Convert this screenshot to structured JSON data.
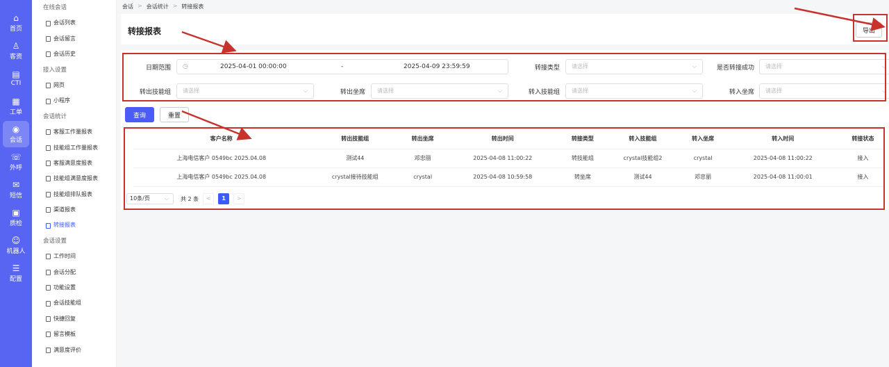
{
  "rail": [
    {
      "icon": "⌂",
      "label": "首页",
      "name": "home"
    },
    {
      "icon": "♙",
      "label": "客资",
      "name": "leads"
    },
    {
      "icon": "▤",
      "label": "CTI",
      "name": "cti"
    },
    {
      "icon": "▦",
      "label": "工单",
      "name": "ticket"
    },
    {
      "icon": "◉",
      "label": "会话",
      "name": "chat",
      "active": true
    },
    {
      "icon": "☏",
      "label": "外呼",
      "name": "outbound"
    },
    {
      "icon": "✉",
      "label": "短信",
      "name": "sms"
    },
    {
      "icon": "▣",
      "label": "质检",
      "name": "qa"
    },
    {
      "icon": "☺",
      "label": "机器人",
      "name": "robot"
    },
    {
      "icon": "☰",
      "label": "配置",
      "name": "config"
    }
  ],
  "menu": [
    {
      "type": "group",
      "label": "在线会话"
    },
    {
      "type": "item",
      "label": "会话列表"
    },
    {
      "type": "item",
      "label": "会话留言"
    },
    {
      "type": "item",
      "label": "会话历史"
    },
    {
      "type": "group",
      "label": "接入设置"
    },
    {
      "type": "item",
      "label": "网页"
    },
    {
      "type": "item",
      "label": "小程序"
    },
    {
      "type": "group",
      "label": "会话统计"
    },
    {
      "type": "item",
      "label": "客服工作量报表"
    },
    {
      "type": "item",
      "label": "技能组工作量报表"
    },
    {
      "type": "item",
      "label": "客服满意度报表"
    },
    {
      "type": "item",
      "label": "技能组满意度报表"
    },
    {
      "type": "item",
      "label": "技能组排队报表"
    },
    {
      "type": "item",
      "label": "渠道报表"
    },
    {
      "type": "item",
      "label": "转接报表",
      "active": true
    },
    {
      "type": "group",
      "label": "会话设置"
    },
    {
      "type": "item",
      "label": "工作时间"
    },
    {
      "type": "item",
      "label": "会话分配"
    },
    {
      "type": "item",
      "label": "功能设置"
    },
    {
      "type": "item",
      "label": "会话技能组"
    },
    {
      "type": "item",
      "label": "快捷回复"
    },
    {
      "type": "item",
      "label": "留言模板"
    },
    {
      "type": "item",
      "label": "满意度评价"
    }
  ],
  "breadcrumb": {
    "c1": "会话",
    "c2": "会话统计",
    "c3": "转接报表",
    "sep": ">"
  },
  "header": {
    "title": "转接报表",
    "export_label": "导出"
  },
  "filters": {
    "date_label": "日期范围",
    "date_start": "2025-04-01 00:00:00",
    "date_sep": "-",
    "date_end": "2025-04-09 23:59:59",
    "transfer_type_label": "转接类型",
    "success_label": "是否转接成功",
    "out_group_label": "转出技能组",
    "out_agent_label": "转出坐席",
    "in_group_label": "转入技能组",
    "in_agent_label": "转入坐席",
    "placeholder": "请选择",
    "query_label": "查询",
    "reset_label": "重置"
  },
  "table": {
    "headers": [
      "客户名称",
      "转出技能组",
      "转出坐席",
      "转出时间",
      "转接类型",
      "转入技能组",
      "转入坐席",
      "转入时间",
      "转接状态"
    ],
    "rows": [
      [
        "上海电信客户 0549bc 2025.04.08",
        "测试44",
        "邓忠丽",
        "2025-04-08 11:00:22",
        "转技能组",
        "crystal技能组2",
        "crystal",
        "2025-04-08 11:00:22",
        "接入"
      ],
      [
        "上海电信客户 0549bc 2025.04.08",
        "crystal接待技能组",
        "crystal",
        "2025-04-08 10:59:58",
        "转坐席",
        "测试44",
        "邓忠丽",
        "2025-04-08 11:00:01",
        "接入"
      ]
    ]
  },
  "pagination": {
    "page_size": "10条/页",
    "total": "共 2 条",
    "current": "1",
    "prev": "<",
    "next": ">"
  },
  "colors": {
    "rail": "#5865f2",
    "accent": "#3b5bfd",
    "annotation": "#c8322c"
  }
}
